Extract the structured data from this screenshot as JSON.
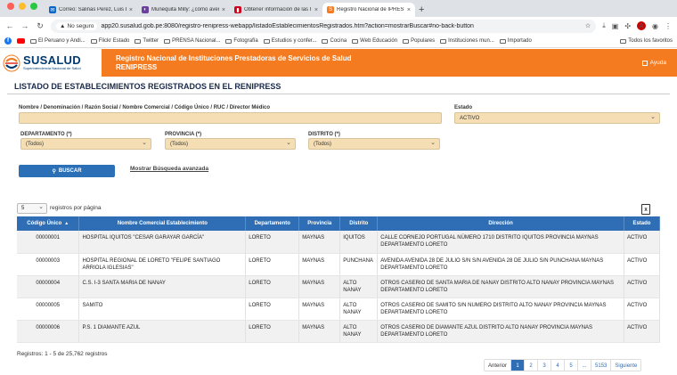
{
  "browser": {
    "tabs": [
      {
        "title": "Correo: Salinas Perez, Luis E...",
        "fav_color": "#0a64c8",
        "active": false
      },
      {
        "title": "Muñequita Milly: ¿cómo aver...",
        "fav_color": "#6a3fa0",
        "active": false
      },
      {
        "title": "Obtener información de las I...",
        "fav_color": "#d0021b",
        "active": false
      },
      {
        "title": "Registro Nacional de IPRESS",
        "fav_color": "#f47b20",
        "active": true
      }
    ],
    "security_label": "No seguro",
    "url": "app20.susalud.gob.pe:8080/registro-renipress-webapp/listadoEstablecimientosRegistrados.htm?action=mostrarBuscar#no-back-button",
    "bookmarks": [
      "El Peruano y Andi...",
      "Flickr Estado",
      "Twitter",
      "PRENSA Nacional...",
      "Fotografía",
      "Estudios y confer...",
      "Cocina",
      "Web Educación",
      "Populares",
      "Instituciones mun...",
      "Importado"
    ],
    "all_bookmarks": "Todos los favoritos"
  },
  "header": {
    "logo_name": "SUSALUD",
    "logo_sub": "Superintendencia Nacional de Salud",
    "title_line1": "Registro Nacional de Instituciones Prestadoras de Servicios de Salud",
    "title_line2": "RENIPRESS",
    "help": "Ayuda",
    "color": "#f47b20"
  },
  "page": {
    "title": "LISTADO DE ESTABLECIMIENTOS REGISTRADOS EN EL RENIPRESS"
  },
  "form": {
    "search_label": "Nombre / Denominación / Razón Social / Nombre Comercial / Código Único / RUC / Director Médico",
    "search_value": "",
    "estado_label": "Estado",
    "estado_value": "ACTIVO",
    "departamento_label": "DEPARTAMENTO (*)",
    "departamento_value": "(Todos)",
    "provincia_label": "PROVINCIA (*)",
    "provincia_value": "(Todos)",
    "distrito_label": "DISTRITO (*)",
    "distrito_value": "(Todos)",
    "buscar_label": "BUSCAR",
    "advanced_label": "Mostrar Búsqueda avanzada"
  },
  "list": {
    "page_size": "5",
    "page_size_label": "registros por página",
    "export_label": "X",
    "columns": [
      "Código Único",
      "Nombre Comercial Establecimiento",
      "Departamento",
      "Provincia",
      "Distrito",
      "Dirección",
      "Estado"
    ],
    "rows": [
      {
        "codigo": "00000001",
        "nombre": "HOSPITAL IQUITOS \"CESAR GARAYAR GARCÍA\"",
        "departamento": "LORETO",
        "provincia": "MAYNAS",
        "distrito": "IQUITOS",
        "direccion": "CALLE CORNEJO PORTUGAL NÚMERO 1710 DISTRITO IQUITOS PROVINCIA MAYNAS DEPARTAMENTO LORETO",
        "estado": "ACTIVO"
      },
      {
        "codigo": "00000003",
        "nombre": "HOSPITAL REGIONAL DE LORETO \"FELIPE SANTIAGO ARRIOLA IGLESIAS\"",
        "departamento": "LORETO",
        "provincia": "MAYNAS",
        "distrito": "PUNCHANA",
        "direccion": "AVENIDA AVENIDA 28 DE JULIO S/N S/N AVENIDA 28 DE JULIO S/N PUNCHANA MAYNAS DEPARTAMENTO LORETO",
        "estado": "ACTIVO"
      },
      {
        "codigo": "00000004",
        "nombre": "C.S. I-3 SANTA MARIA DE NANAY",
        "departamento": "LORETO",
        "provincia": "MAYNAS",
        "distrito": "ALTO NANAY",
        "direccion": "OTROS CASERIO DE SANTA MARIA DE NANAY DISTRITO ALTO NANAY PROVINCIA MAYNAS DEPARTAMENTO LORETO",
        "estado": "ACTIVO"
      },
      {
        "codigo": "00000005",
        "nombre": "SAMITO",
        "departamento": "LORETO",
        "provincia": "MAYNAS",
        "distrito": "ALTO NANAY",
        "direccion": "OTROS CASERIO DE SAMITO S/N NUMERO DISTRITO ALTO NANAY PROVINCIA MAYNAS DEPARTAMENTO LORETO",
        "estado": "ACTIVO"
      },
      {
        "codigo": "00000006",
        "nombre": "P.S. 1 DIAMANTE AZUL",
        "departamento": "LORETO",
        "provincia": "MAYNAS",
        "distrito": "ALTO NANAY",
        "direccion": "OTROS CASERIO DE DIAMANTE AZUL DISTRITO ALTO NANAY PROVINCIA MAYNAS DEPARTAMENTO LORETO",
        "estado": "ACTIVO"
      }
    ],
    "summary": "Registros: 1 - 5 de 25,762 registros",
    "pagination": {
      "prev": "Anterior",
      "pages": [
        "1",
        "2",
        "3",
        "4",
        "5",
        "...",
        "5153"
      ],
      "current": "1",
      "next": "Siguiente"
    }
  }
}
